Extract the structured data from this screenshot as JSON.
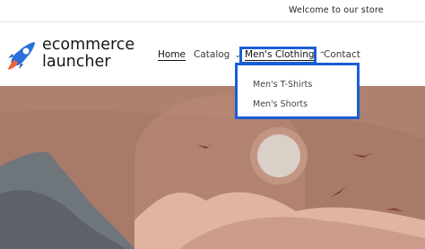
{
  "announcement": {
    "text": "Welcome to our store"
  },
  "logo": {
    "line1": "ecommerce",
    "line2": "launcher",
    "icon": "rocket-icon"
  },
  "nav": {
    "home": "Home",
    "catalog": "Catalog",
    "mens_clothing": "Men's Clothing",
    "contact": "Contact",
    "catalog_chevron": "chevron-down-icon",
    "mens_chevron": "chevron-up-icon"
  },
  "dropdown": {
    "items": [
      "Men's T-Shirts",
      "Men's Shorts"
    ]
  },
  "colors": {
    "highlight": "#1a5ed6",
    "hero_bg": "#a77a6a"
  }
}
